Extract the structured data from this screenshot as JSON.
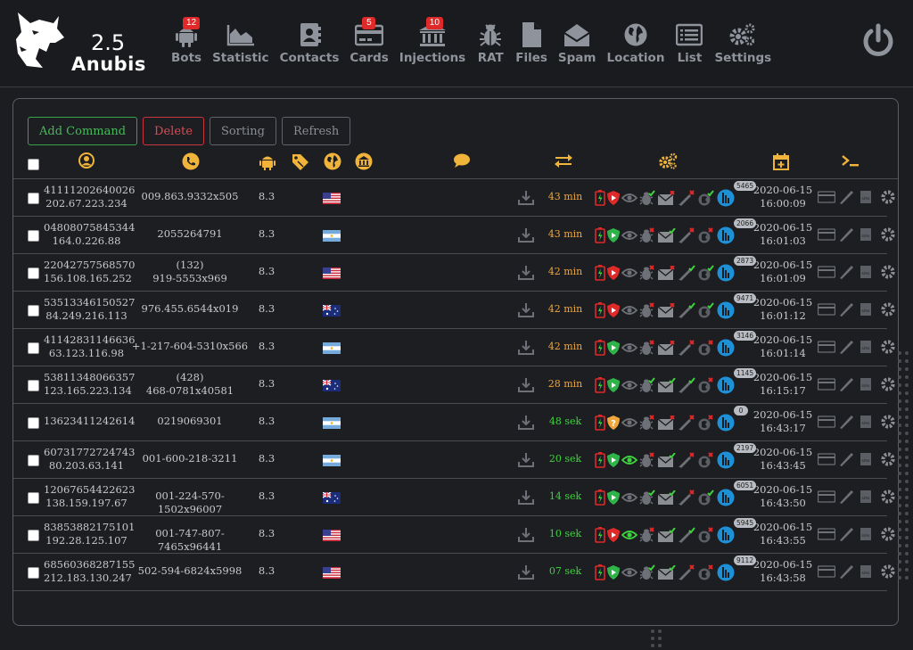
{
  "brand": {
    "version": "2.5",
    "name": "Anubis"
  },
  "nav": [
    {
      "key": "bots",
      "label": "Bots",
      "badge": "12",
      "icon": "android-icon"
    },
    {
      "key": "statistic",
      "label": "Statistic",
      "badge": null,
      "icon": "area-chart-icon"
    },
    {
      "key": "contacts",
      "label": "Contacts",
      "badge": null,
      "icon": "contacts-book-icon"
    },
    {
      "key": "cards",
      "label": "Cards",
      "badge": "5",
      "icon": "credit-card-icon"
    },
    {
      "key": "injections",
      "label": "Injections",
      "badge": "10",
      "icon": "bank-icon"
    },
    {
      "key": "rat",
      "label": "RAT",
      "badge": null,
      "icon": "bug-icon"
    },
    {
      "key": "files",
      "label": "Files",
      "badge": null,
      "icon": "file-icon"
    },
    {
      "key": "spam",
      "label": "Spam",
      "badge": null,
      "icon": "envelope-open-icon"
    },
    {
      "key": "location",
      "label": "Location",
      "badge": null,
      "icon": "globe-icon"
    },
    {
      "key": "list",
      "label": "List",
      "badge": null,
      "icon": "list-icon"
    },
    {
      "key": "settings",
      "label": "Settings",
      "badge": null,
      "icon": "gears-icon"
    }
  ],
  "buttons": {
    "add_command": "Add Command",
    "delete": "Delete",
    "sorting": "Sorting",
    "refresh": "Refresh"
  },
  "columns": [
    "select",
    "user-icon",
    "phone-icon",
    "android-icon",
    "tag-icon",
    "globe-icon",
    "bank-icon",
    "comment-icon",
    "exchange-icon",
    "gears-icon",
    "calendar-plus-icon",
    "terminal-icon"
  ],
  "colors": {
    "accent": "#f0b43a",
    "green": "#3fd23f",
    "orange": "#f0a63a",
    "red": "#e02929",
    "blue": "#1e90d6"
  },
  "rows": [
    {
      "id": "41111202640026",
      "ip": "202.67.223.234",
      "phone": [
        "009.863.9332x505"
      ],
      "version": "8.3",
      "flag": "us",
      "time": "43 min",
      "time_color": "orange",
      "shield": "red",
      "eye": "grey",
      "bug": "ok",
      "mail": "x",
      "pen": "x",
      "rat": "ok",
      "count": "5465",
      "date": "2020-06-15",
      "clock": "16:00:09"
    },
    {
      "id": "04808075845344",
      "ip": "164.0.226.88",
      "phone": [
        "2055264791"
      ],
      "version": "8.3",
      "flag": "ar",
      "time": "43 min",
      "time_color": "orange",
      "shield": "green",
      "eye": "grey",
      "bug": "x",
      "mail": "ok",
      "pen": "x",
      "rat": "x",
      "count": "2066",
      "date": "2020-06-15",
      "clock": "16:01:03"
    },
    {
      "id": "22042757568570",
      "ip": "156.108.165.252",
      "phone": [
        "(132)",
        "919-5553x969"
      ],
      "version": "8.3",
      "flag": "us",
      "time": "42 min",
      "time_color": "orange",
      "shield": "red",
      "eye": "grey",
      "bug": "x",
      "mail": "x",
      "pen": "ok",
      "rat": "ok",
      "count": "2873",
      "date": "2020-06-15",
      "clock": "16:01:09"
    },
    {
      "id": "53513346150527",
      "ip": "84.249.216.113",
      "phone": [
        "976.455.6544x019"
      ],
      "version": "8.3",
      "flag": "au",
      "time": "42 min",
      "time_color": "orange",
      "shield": "red",
      "eye": "grey",
      "bug": "x",
      "mail": "x",
      "pen": "ok",
      "rat": "ok",
      "count": "9471",
      "date": "2020-06-15",
      "clock": "16:01:12"
    },
    {
      "id": "41142831146636",
      "ip": "63.123.116.98",
      "phone": [
        "+1-217-604-5310x566"
      ],
      "version": "8.3",
      "flag": "ar",
      "time": "42 min",
      "time_color": "orange",
      "shield": "green",
      "eye": "grey",
      "bug": "x",
      "mail": "x",
      "pen": "x",
      "rat": "x",
      "count": "3146",
      "date": "2020-06-15",
      "clock": "16:01:14"
    },
    {
      "id": "53811348066357",
      "ip": "123.165.223.134",
      "phone": [
        "(428)",
        "468-0781x40581"
      ],
      "version": "8.3",
      "flag": "au",
      "time": "28 min",
      "time_color": "orange",
      "shield": "green",
      "eye": "grey",
      "bug": "ok",
      "mail": "ok",
      "pen": "ok",
      "rat": "x",
      "count": "1145",
      "date": "2020-06-15",
      "clock": "16:15:17"
    },
    {
      "id": "13623411242614",
      "ip": "",
      "phone": [
        "0219069301"
      ],
      "version": "8.3",
      "flag": "ar",
      "time": "48 sek",
      "time_color": "green",
      "shield": "orange",
      "eye": "grey",
      "bug": "x",
      "mail": "x",
      "pen": "x",
      "rat": "x",
      "count": "0",
      "date": "2020-06-15",
      "clock": "16:43:17"
    },
    {
      "id": "60731772724743",
      "ip": "80.203.63.141",
      "phone": [
        "001-600-218-3211"
      ],
      "version": "8.3",
      "flag": "ar",
      "time": "20 sek",
      "time_color": "green",
      "shield": "green",
      "eye": "green",
      "bug": "x",
      "mail": "ok",
      "pen": "x",
      "rat": "x",
      "count": "2197",
      "date": "2020-06-15",
      "clock": "16:43:45"
    },
    {
      "id": "12067654422623",
      "ip": "138.159.197.67",
      "phone": [
        "001-224-570-1502x96007"
      ],
      "version": "8.3",
      "flag": "au",
      "time": "14 sek",
      "time_color": "green",
      "shield": "green",
      "eye": "grey",
      "bug": "ok",
      "mail": "ok",
      "pen": "x",
      "rat": "ok",
      "count": "6051",
      "date": "2020-06-15",
      "clock": "16:43:50"
    },
    {
      "id": "83853882175101",
      "ip": "192.28.125.107",
      "phone": [
        "001-747-807-7465x96441"
      ],
      "version": "8.3",
      "flag": "us",
      "time": "10 sek",
      "time_color": "green",
      "shield": "red",
      "eye": "green",
      "bug": "x",
      "mail": "ok",
      "pen": "ok",
      "rat": "x",
      "count": "5945",
      "date": "2020-06-15",
      "clock": "16:43:55"
    },
    {
      "id": "68560368287155",
      "ip": "212.183.130.247",
      "phone": [
        "502-594-6824x5998"
      ],
      "version": "8.3",
      "flag": "us",
      "time": "07 sek",
      "time_color": "green",
      "shield": "green",
      "eye": "grey",
      "bug": "ok",
      "mail": "ok",
      "pen": "x",
      "rat": "x",
      "count": "9112",
      "date": "2020-06-15",
      "clock": "16:43:58"
    }
  ]
}
